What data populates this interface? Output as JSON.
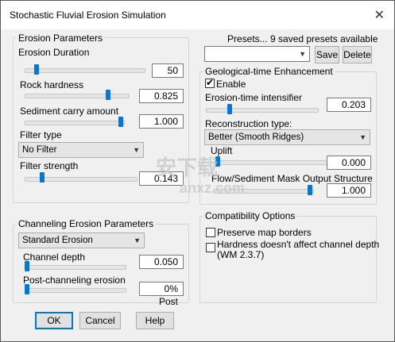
{
  "window": {
    "title": "Stochastic Fluvial Erosion Simulation",
    "close_glyph": "✕"
  },
  "erosion": {
    "group_title": "Erosion Parameters",
    "duration": {
      "label": "Erosion Duration",
      "value": "50",
      "fraction": 0.08
    },
    "rock_hardness": {
      "label": "Rock hardness",
      "value": "0.825",
      "fraction": 0.82
    },
    "sediment": {
      "label": "Sediment carry amount",
      "value": "1.000",
      "fraction": 1.0
    },
    "filter_type": {
      "label": "Filter type",
      "value": "No Filter"
    },
    "filter_strength": {
      "label": "Filter strength",
      "value": "0.143",
      "fraction": 0.14
    }
  },
  "channeling": {
    "group_title": "Channeling Erosion Parameters",
    "mode": "Standard Erosion",
    "depth": {
      "label": "Channel depth",
      "value": "0.050",
      "fraction": 0.0
    },
    "post": {
      "label": "Post-channeling erosion",
      "value": "0% Post",
      "fraction": 0.0
    }
  },
  "presets": {
    "label": "Presets... 9 saved presets available",
    "save": "Save",
    "delete": "Delete",
    "combo_value": ""
  },
  "geo": {
    "group_title": "Geological-time Enhancement",
    "enable_label": "Enable",
    "enable_checked": true,
    "intensifier": {
      "label": "Erosion-time intensifier",
      "value": "0.203",
      "fraction": 0.2
    },
    "recon": {
      "label": "Reconstruction type:",
      "value": "Better (Smooth Ridges)"
    },
    "uplift": {
      "label": "Uplift",
      "value": "0.000",
      "fraction": 0.0
    },
    "flow": {
      "label": "Flow/Sediment Mask Output Structure",
      "value": "1.000",
      "fraction": 1.0
    }
  },
  "compat": {
    "group_title": "Compatibility Options",
    "preserve": {
      "label": "Preserve map borders",
      "checked": false
    },
    "hardness": {
      "label_line1": "Hardness doesn't affect channel depth",
      "label_line2": "(WM 2.3.7)",
      "checked": false
    }
  },
  "buttons": {
    "ok": "OK",
    "cancel": "Cancel",
    "help": "Help"
  },
  "watermark": {
    "text": "安下载",
    "domain": "anxz.com"
  },
  "colors": {
    "accent": "#0078d7",
    "bg": "#f0f0f0"
  }
}
